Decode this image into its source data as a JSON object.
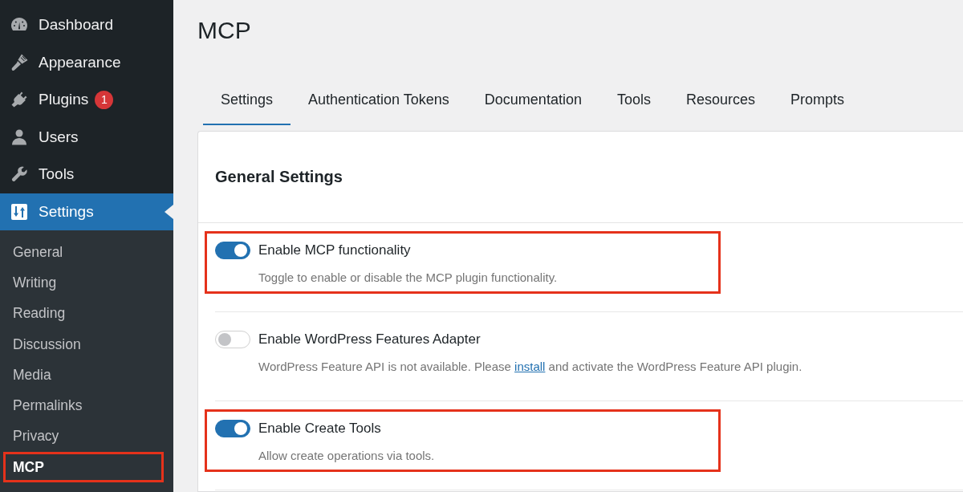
{
  "sidebar": {
    "menu": [
      {
        "label": "Dashboard",
        "selected": false
      },
      {
        "label": "Appearance",
        "selected": false
      },
      {
        "label": "Plugins",
        "selected": false,
        "badge": "1"
      },
      {
        "label": "Users",
        "selected": false
      },
      {
        "label": "Tools",
        "selected": false
      },
      {
        "label": "Settings",
        "selected": true
      }
    ],
    "submenu": [
      {
        "label": "General",
        "selected": false,
        "highlighted": false
      },
      {
        "label": "Writing",
        "selected": false,
        "highlighted": false
      },
      {
        "label": "Reading",
        "selected": false,
        "highlighted": false
      },
      {
        "label": "Discussion",
        "selected": false,
        "highlighted": false
      },
      {
        "label": "Media",
        "selected": false,
        "highlighted": false
      },
      {
        "label": "Permalinks",
        "selected": false,
        "highlighted": false
      },
      {
        "label": "Privacy",
        "selected": false,
        "highlighted": false
      },
      {
        "label": "MCP",
        "selected": true,
        "highlighted": true
      }
    ]
  },
  "page": {
    "title": "MCP"
  },
  "tabs": [
    {
      "label": "Settings",
      "selected": true
    },
    {
      "label": "Authentication Tokens",
      "selected": false
    },
    {
      "label": "Documentation",
      "selected": false
    },
    {
      "label": "Tools",
      "selected": false
    },
    {
      "label": "Resources",
      "selected": false
    },
    {
      "label": "Prompts",
      "selected": false
    }
  ],
  "settings_card": {
    "heading": "General Settings",
    "rows": [
      {
        "label": "Enable MCP functionality",
        "on": true,
        "highlighted": true,
        "description": [
          {
            "kind": "text",
            "text": "Toggle to enable or disable the MCP plugin functionality."
          }
        ]
      },
      {
        "label": "Enable WordPress Features Adapter",
        "on": false,
        "highlighted": false,
        "description": [
          {
            "kind": "text",
            "text": "WordPress Feature API is not available. Please "
          },
          {
            "kind": "link",
            "text": "install"
          },
          {
            "kind": "text",
            "text": " and activate the WordPress Feature API plugin."
          }
        ]
      },
      {
        "label": "Enable Create Tools",
        "on": true,
        "highlighted": true,
        "description": [
          {
            "kind": "text",
            "text": "Allow create operations via tools."
          }
        ]
      }
    ]
  }
}
